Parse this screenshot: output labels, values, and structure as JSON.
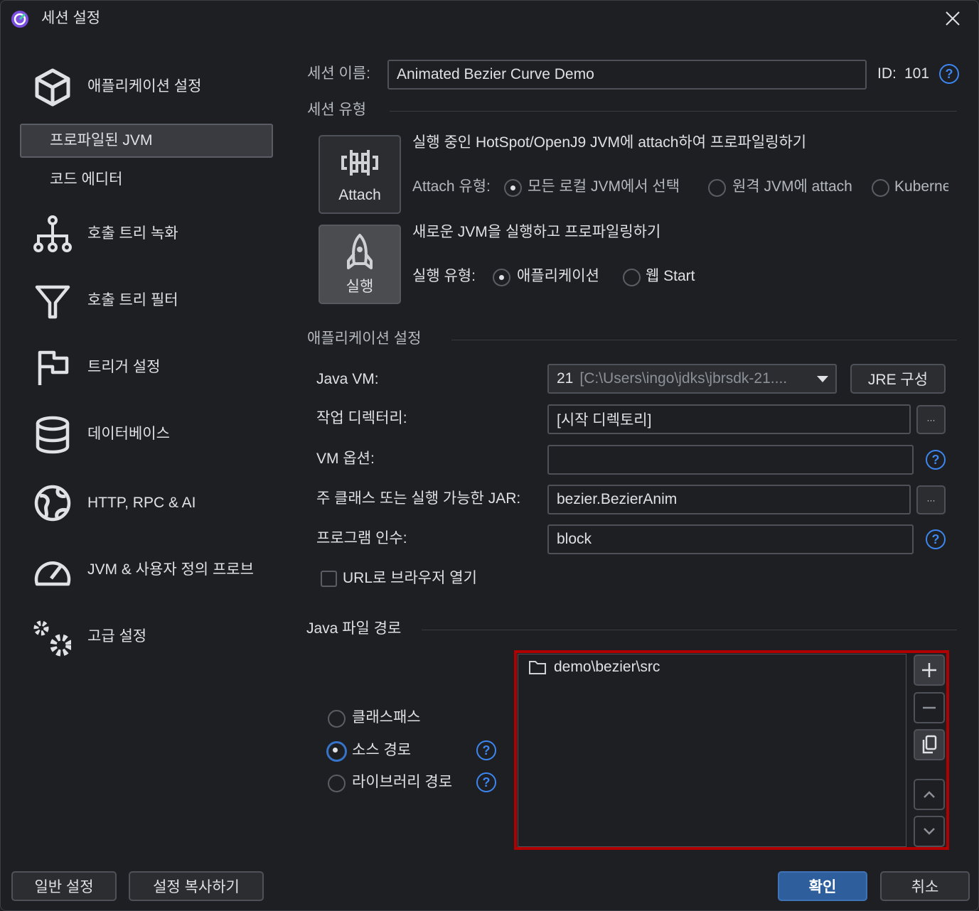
{
  "window": {
    "title": "세션 설정"
  },
  "sidebar": {
    "items": [
      {
        "label": "애플리케이션 설정",
        "icon": "cube-icon"
      },
      {
        "label": "프로파일된 JVM",
        "selected": true
      },
      {
        "label": "코드 에디터"
      },
      {
        "label": "호출 트리 녹화",
        "icon": "tree-icon"
      },
      {
        "label": "호출 트리 필터",
        "icon": "filter-icon"
      },
      {
        "label": "트리거 설정",
        "icon": "flag-icon"
      },
      {
        "label": "데이터베이스",
        "icon": "database-icon"
      },
      {
        "label": "HTTP, RPC & AI",
        "icon": "globe-icon"
      },
      {
        "label": "JVM & 사용자 정의 프로브",
        "icon": "gauge-icon"
      },
      {
        "label": "고급 설정",
        "icon": "gears-icon"
      }
    ]
  },
  "session": {
    "name_label": "세션 이름:",
    "name_value": "Animated Bezier Curve Demo",
    "id_label": "ID:",
    "id_value": "101",
    "type_header": "세션 유형",
    "attach": {
      "button": "Attach",
      "desc": "실행 중인 HotSpot/OpenJ9 JVM에 attach하여 프로파일링하기",
      "type_label": "Attach 유형:",
      "options": [
        "모든 로컬 JVM에서 선택",
        "원격 JVM에 attach",
        "Kuberne"
      ]
    },
    "launch": {
      "button": "실행",
      "desc": "새로운 JVM을 실행하고 프로파일링하기",
      "type_label": "실행 유형:",
      "options": [
        "애플리케이션",
        "웹 Start"
      ]
    }
  },
  "app_settings": {
    "header": "애플리케이션 설정",
    "java_vm_label": "Java VM:",
    "java_vm_version": "21",
    "java_vm_path": "[C:\\Users\\ingo\\jdks\\jbrsdk-21....",
    "jre_button": "JRE 구성",
    "workdir_label": "작업 디렉터리:",
    "workdir_value": "[시작 디렉토리]",
    "browse": "···",
    "vm_options_label": "VM 옵션:",
    "vm_options_value": "",
    "main_class_label": "주 클래스 또는 실행 가능한 JAR:",
    "main_class_value": "bezier.BezierAnim",
    "args_label": "프로그램 인수:",
    "args_value": "block",
    "open_browser_label": "URL로 브라우저 열기",
    "open_browser_checked": false
  },
  "java_paths": {
    "header": "Java 파일 경로",
    "options": [
      "클래스패스",
      "소스 경로",
      "라이브러리 경로"
    ],
    "selected": "소스 경로",
    "entries": [
      "demo\\bezier\\src"
    ]
  },
  "footer": {
    "general": "일반 설정",
    "copy": "설정 복사하기",
    "ok": "확인",
    "cancel": "취소"
  },
  "colors": {
    "accent": "#2e5f9c",
    "highlight": "#c00000",
    "help": "#3d86f0"
  }
}
